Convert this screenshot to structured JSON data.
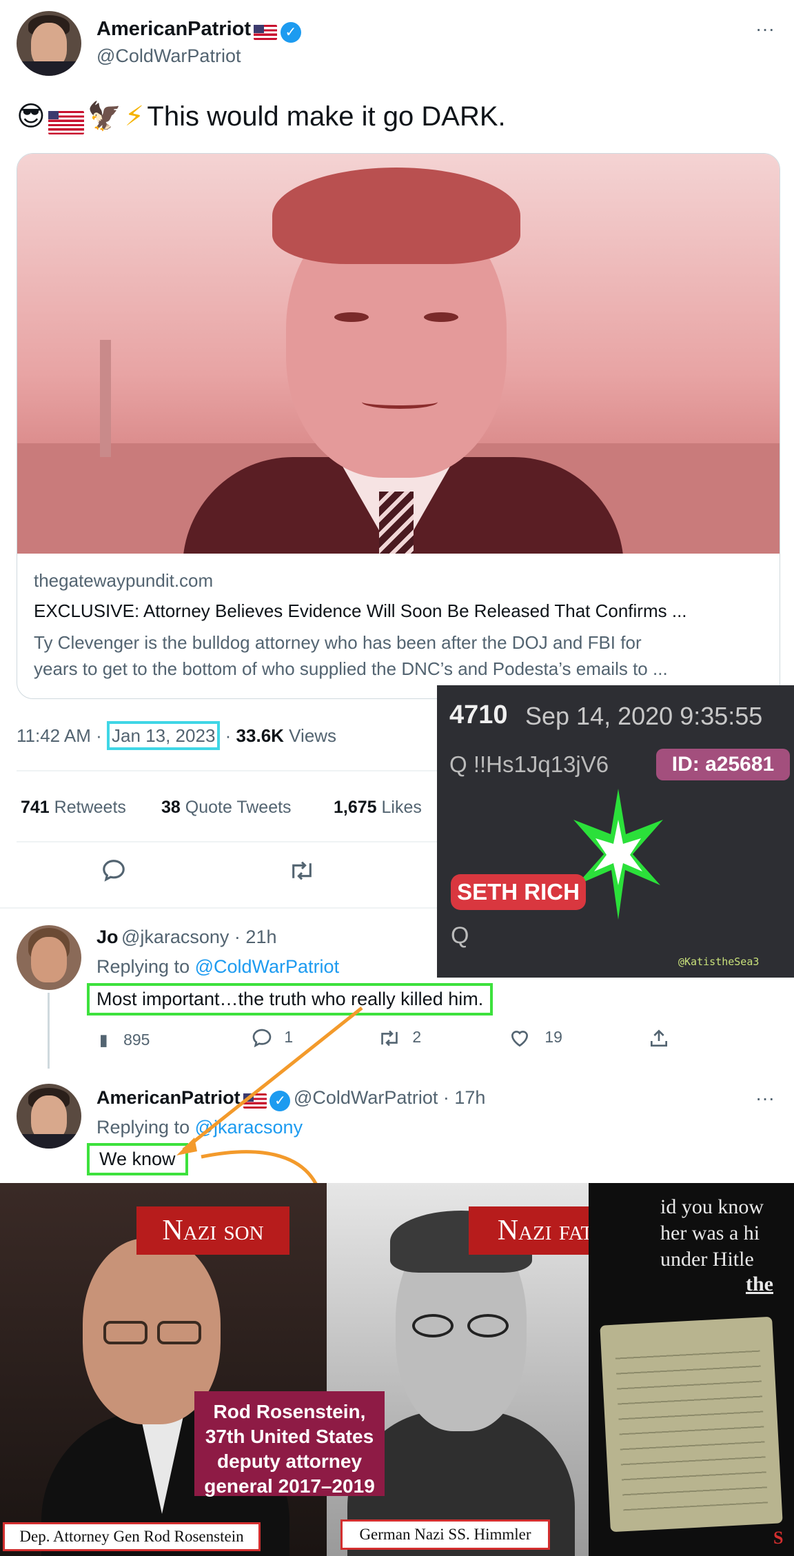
{
  "tweet": {
    "author_name": "AmericanPatriot",
    "author_handle": "@ColdWarPatriot",
    "more": "···",
    "emojis": "😎",
    "eagle": "🦅",
    "bolt": "⚡",
    "text": "This would make it go DARK.",
    "card": {
      "domain": "thegatewaypundit.com",
      "title": "EXCLUSIVE: Attorney Believes Evidence Will Soon Be Released That Confirms ...",
      "desc_line1": "Ty Clevenger is the bulldog attorney who has been after the DOJ and FBI for",
      "desc_line2": "years to get to the bottom of who supplied the DNC’s and Podesta’s emails to ..."
    },
    "time": "11:42 AM ·",
    "date": "Jan 13, 2023",
    "views_sep": "·",
    "views_count": "33.6K",
    "views_label": "Views",
    "retweets_count": "741",
    "retweets_label": "Retweets",
    "quotes_count": "38",
    "quotes_label": "Quote Tweets",
    "likes_count": "1,675",
    "likes_label": "Likes"
  },
  "reply1": {
    "name": "Jo",
    "handle": "@jkaracsony · 21h",
    "replying_prefix": "Replying to",
    "replying_to": "@ColdWarPatriot",
    "text": "Most important…the truth who really killed him.",
    "views": "895",
    "replies": "1",
    "retweets": "2",
    "likes": "19"
  },
  "reply2": {
    "name": "AmericanPatriot",
    "handle": "@ColdWarPatriot · 17h",
    "replying_prefix": "Replying to",
    "replying_to": "@jkaracsony",
    "text": "We know",
    "more": "···"
  },
  "qpost": {
    "number": "4710",
    "date": "Sep 14, 2020 9:35:55",
    "trip": "Q  !!Hs1Jq13jV6",
    "id": "ID: a25681",
    "tag": "SETH RICH",
    "sign": "Q",
    "watermark": "@KatistheSea3"
  },
  "collage": {
    "banner_left": "Nazi son",
    "banner_right": "Nazi father",
    "rod_box": "Rod Rosenstein, 37th United States deputy attorney general 2017–2019",
    "caption_left": "Dep. Attorney Gen Rod Rosenstein",
    "caption_right": "German Nazi SS. Himmler",
    "side_text_1": "id you know",
    "side_text_2": "her was a hi",
    "side_text_3": "under Hitle",
    "side_text_4": "the",
    "side_text_5": "S"
  }
}
